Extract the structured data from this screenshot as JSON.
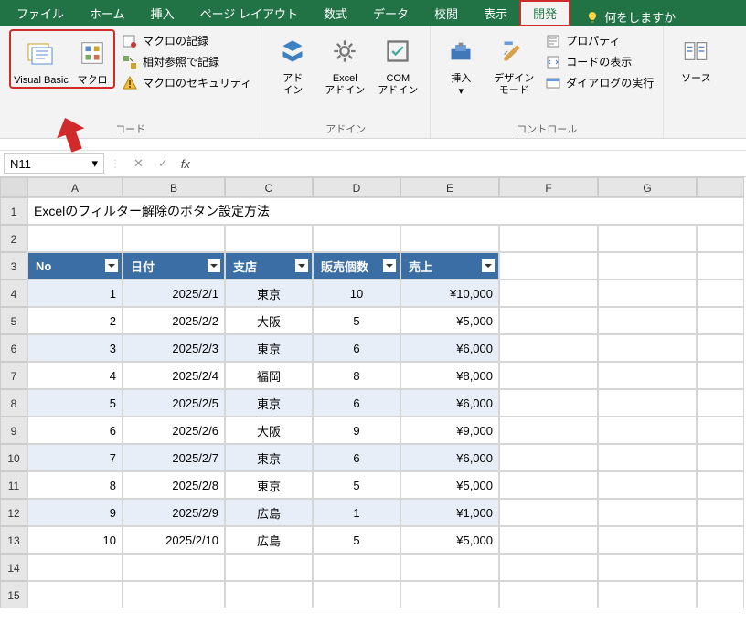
{
  "menu": [
    "ファイル",
    "ホーム",
    "挿入",
    "ページ レイアウト",
    "数式",
    "データ",
    "校閲",
    "表示",
    "開発"
  ],
  "active_tab": "開発",
  "help_prompt": "何をしますか",
  "ribbon": {
    "code": {
      "vb": "Visual Basic",
      "mac": "マクロ",
      "rec": "マクロの記録",
      "rel": "相対参照で記録",
      "sec": "マクロのセキュリティ",
      "group": "コード"
    },
    "addins": {
      "adin": "アド\nイン",
      "excel": "Excel\nアドイン",
      "com": "COM\nアドイン",
      "group": "アドイン"
    },
    "controls": {
      "ins": "挿入",
      "design": "デザイン\nモード",
      "prop": "プロパティ",
      "view": "コードの表示",
      "dlg": "ダイアログの実行",
      "group": "コントロール"
    },
    "src": {
      "label": "ソース"
    }
  },
  "namebox": "N11",
  "fx_value": "",
  "columns": [
    "A",
    "B",
    "C",
    "D",
    "E",
    "F",
    "G",
    ""
  ],
  "rownums": [
    1,
    2,
    3,
    4,
    5,
    6,
    7,
    8,
    9,
    10,
    11,
    12,
    13,
    14,
    15
  ],
  "title": "Excelのフィルター解除のボタン設定方法",
  "headers": [
    "No",
    "日付",
    "支店",
    "販売個数",
    "売上"
  ],
  "chart_data": {
    "type": "table",
    "columns": [
      "No",
      "日付",
      "支店",
      "販売個数",
      "売上"
    ],
    "rows": [
      {
        "no": 1,
        "date": "2025/2/1",
        "branch": "東京",
        "qty": 10,
        "sales": "¥10,000"
      },
      {
        "no": 2,
        "date": "2025/2/2",
        "branch": "大阪",
        "qty": 5,
        "sales": "¥5,000"
      },
      {
        "no": 3,
        "date": "2025/2/3",
        "branch": "東京",
        "qty": 6,
        "sales": "¥6,000"
      },
      {
        "no": 4,
        "date": "2025/2/4",
        "branch": "福岡",
        "qty": 8,
        "sales": "¥8,000"
      },
      {
        "no": 5,
        "date": "2025/2/5",
        "branch": "東京",
        "qty": 6,
        "sales": "¥6,000"
      },
      {
        "no": 6,
        "date": "2025/2/6",
        "branch": "大阪",
        "qty": 9,
        "sales": "¥9,000"
      },
      {
        "no": 7,
        "date": "2025/2/7",
        "branch": "東京",
        "qty": 6,
        "sales": "¥6,000"
      },
      {
        "no": 8,
        "date": "2025/2/8",
        "branch": "東京",
        "qty": 5,
        "sales": "¥5,000"
      },
      {
        "no": 9,
        "date": "2025/2/9",
        "branch": "広島",
        "qty": 1,
        "sales": "¥1,000"
      },
      {
        "no": 10,
        "date": "2025/2/10",
        "branch": "広島",
        "qty": 5,
        "sales": "¥5,000"
      }
    ]
  }
}
